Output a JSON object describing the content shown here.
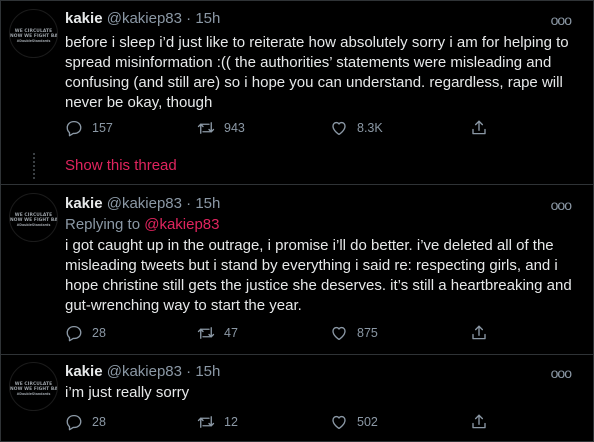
{
  "colors": {
    "background": "#000000",
    "text": "#e7e9ea",
    "secondary": "#8b98a5",
    "accent": "#e0245e",
    "border": "#2f3336"
  },
  "avatar": {
    "line1": "WE CIRCULATE",
    "line2": "NOW WE FIGHT BACK",
    "line3": "#DoubleStandards"
  },
  "tweets": [
    {
      "name": "kakie",
      "handle": "@kakiep83",
      "time": "· 15h",
      "more": "ooo",
      "replying_label": "",
      "replying_handle": "",
      "text": "before i sleep i’d just like to reiterate how absolutely sorry i am for helping to spread misinformation :(( the authorities’ statements were misleading and confusing (and still are) so i hope you can understand. regardless, rape will never be okay, though",
      "replies": "157",
      "retweets": "943",
      "likes": "8.3K"
    },
    {
      "name": "kakie",
      "handle": "@kakiep83",
      "time": "· 15h",
      "more": "ooo",
      "replying_label": "Replying to",
      "replying_handle": "@kakiep83",
      "text": "i got caught up in the outrage, i promise i’ll do better. i’ve deleted all of the misleading tweets but i stand by everything i said re: respecting girls, and i hope christine still gets the justice she deserves. it’s still a heartbreaking and gut-wrenching way to start the year.",
      "replies": "28",
      "retweets": "47",
      "likes": "875"
    },
    {
      "name": "kakie",
      "handle": "@kakiep83",
      "time": "· 15h",
      "more": "ooo",
      "replying_label": "",
      "replying_handle": "",
      "text": "i’m just really sorry",
      "replies": "28",
      "retweets": "12",
      "likes": "502"
    }
  ],
  "show_thread": "Show this thread",
  "icons": [
    "reply-icon",
    "retweet-icon",
    "like-icon",
    "share-icon",
    "more-icon"
  ]
}
